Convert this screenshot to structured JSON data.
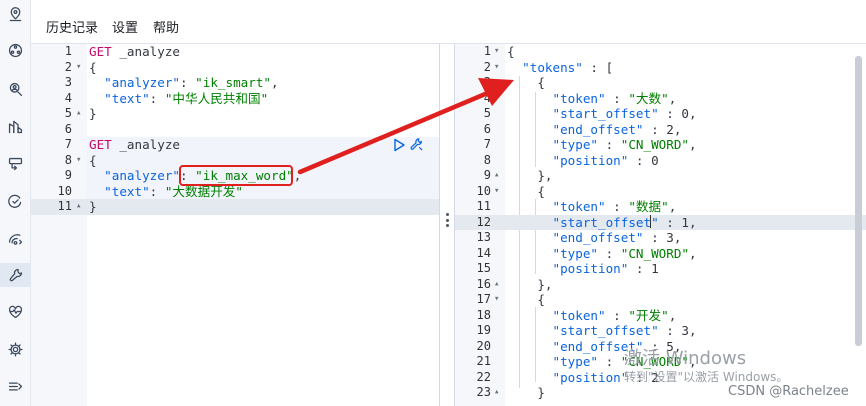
{
  "menu": {
    "history": "历史记录",
    "settings": "设置",
    "help": "帮助"
  },
  "sidebar": {
    "icons": [
      "location-pin-icon",
      "cluster-icon",
      "person-search-icon",
      "chart-icon",
      "console-icon",
      "check-loop-icon",
      "signal-icon",
      "wrench-icon",
      "heartbeat-icon",
      "gear-icon",
      "collapse-menu-icon"
    ]
  },
  "request_editor": {
    "lines": [
      {
        "n": "1",
        "fold": "",
        "code": "GET _analyze"
      },
      {
        "n": "2",
        "fold": "▾",
        "code": "{"
      },
      {
        "n": "3",
        "fold": "",
        "code": "  \"analyzer\": \"ik_smart\","
      },
      {
        "n": "4",
        "fold": "",
        "code": "  \"text\": \"中华人民共和国\""
      },
      {
        "n": "5",
        "fold": "▴",
        "code": "}"
      },
      {
        "n": "6",
        "fold": "",
        "code": ""
      },
      {
        "n": "7",
        "fold": "",
        "code": "GET _analyze"
      },
      {
        "n": "8",
        "fold": "▾",
        "code": "{"
      },
      {
        "n": "9",
        "fold": "",
        "code": "  \"analyzer\": \"ik_max_word\","
      },
      {
        "n": "10",
        "fold": "",
        "code": "  \"text\": \"大数据开发\""
      },
      {
        "n": "11",
        "fold": "▴",
        "code": "}"
      }
    ]
  },
  "response_viewer": {
    "lines": [
      {
        "n": "1",
        "fold": "▾",
        "code": "{"
      },
      {
        "n": "2",
        "fold": "▾",
        "code": "  \"tokens\" : ["
      },
      {
        "n": "3",
        "fold": "▾",
        "code": "    {"
      },
      {
        "n": "4",
        "fold": "",
        "code": "      \"token\" : \"大数\","
      },
      {
        "n": "5",
        "fold": "",
        "code": "      \"start_offset\" : 0,"
      },
      {
        "n": "6",
        "fold": "",
        "code": "      \"end_offset\" : 2,"
      },
      {
        "n": "7",
        "fold": "",
        "code": "      \"type\" : \"CN_WORD\","
      },
      {
        "n": "8",
        "fold": "",
        "code": "      \"position\" : 0"
      },
      {
        "n": "9",
        "fold": "▴",
        "code": "    },"
      },
      {
        "n": "10",
        "fold": "▾",
        "code": "    {"
      },
      {
        "n": "11",
        "fold": "",
        "code": "      \"token\" : \"数据\","
      },
      {
        "n": "12",
        "fold": "",
        "code": "      \"start_offset\" : 1,"
      },
      {
        "n": "13",
        "fold": "",
        "code": "      \"end_offset\" : 3,"
      },
      {
        "n": "14",
        "fold": "",
        "code": "      \"type\" : \"CN_WORD\","
      },
      {
        "n": "15",
        "fold": "",
        "code": "      \"position\" : 1"
      },
      {
        "n": "16",
        "fold": "▴",
        "code": "    },"
      },
      {
        "n": "17",
        "fold": "▾",
        "code": "    {"
      },
      {
        "n": "18",
        "fold": "",
        "code": "      \"token\" : \"开发\","
      },
      {
        "n": "19",
        "fold": "",
        "code": "      \"start_offset\" : 3,"
      },
      {
        "n": "20",
        "fold": "",
        "code": "      \"end_offset\" : 5,"
      },
      {
        "n": "21",
        "fold": "",
        "code": "      \"type\" : \"CN_WORD\","
      },
      {
        "n": "22",
        "fold": "",
        "code": "      \"position\" : 2"
      },
      {
        "n": "23",
        "fold": "▴",
        "code": "    }"
      }
    ]
  },
  "watermark": {
    "title": "激活 Windows",
    "subtitle": "转到\"设置\"以激活 Windows。",
    "csdn": "CSDN @Rachelzee"
  },
  "colors": {
    "method": "#c80a68",
    "key": "#0b64dd",
    "string": "#008000",
    "annotation": "#e0201f"
  }
}
